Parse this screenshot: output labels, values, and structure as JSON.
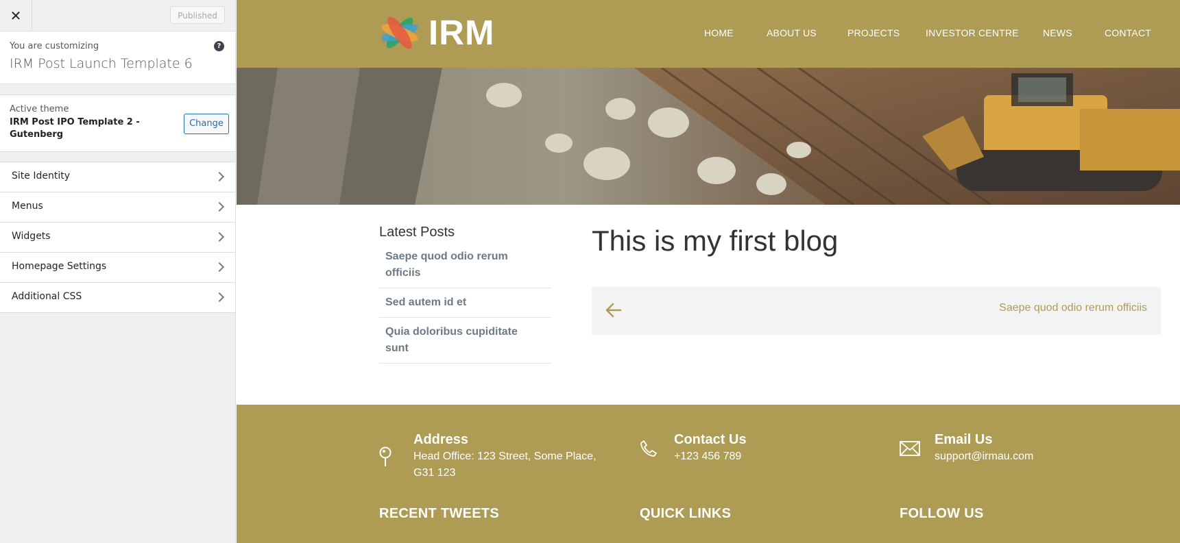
{
  "customizer": {
    "close_icon": "close-icon",
    "publish_label": "Published",
    "customizing_label": "You are customizing",
    "site_name": "IRM Post Launch Template 6",
    "help_glyph": "?",
    "active_theme_label": "Active theme",
    "theme_name": "IRM Post IPO Template 2 - Gutenberg",
    "change_label": "Change",
    "sections": [
      {
        "label": "Site Identity"
      },
      {
        "label": "Menus"
      },
      {
        "label": "Widgets"
      },
      {
        "label": "Homepage Settings"
      },
      {
        "label": "Additional CSS"
      }
    ]
  },
  "site": {
    "brand_color": "#ae9b54",
    "logo_text": "IRM",
    "nav": [
      "HOME",
      "ABOUT US",
      "PROJECTS",
      "INVESTOR CENTRE",
      "NEWS",
      "CONTACT"
    ],
    "latest_posts_title": "Latest Posts",
    "latest_posts": [
      "Saepe quod odio rerum officiis",
      "Sed autem id et",
      "Quia doloribus cupiditate sunt"
    ],
    "post_title": "This is my first blog",
    "next_post_label": "Saepe quod odio rerum officiis",
    "footer": {
      "address_title": "Address",
      "address_text": "Head Office: 123 Street, Some Place, G31 123",
      "contact_title": "Contact Us",
      "contact_text": "+123 456 789",
      "email_title": "Email Us",
      "email_text": "support@irmau.com",
      "columns": [
        "RECENT TWEETS",
        "QUICK LINKS",
        "FOLLOW US"
      ]
    }
  }
}
